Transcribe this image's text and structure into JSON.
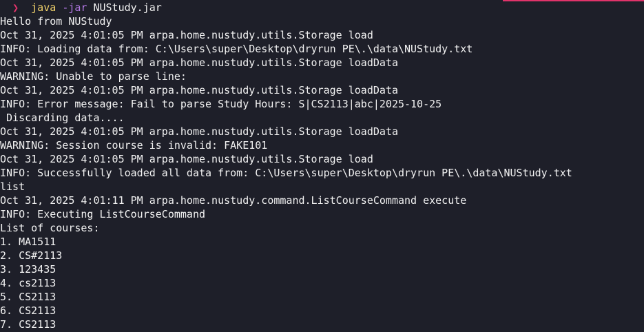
{
  "terminal": {
    "prompt": {
      "caret": "❯",
      "command": "java",
      "flag": "-jar",
      "argument": "NUStudy.jar"
    },
    "output": [
      "Hello from NUStudy",
      "Oct 31, 2025 4:01:05 PM arpa.home.nustudy.utils.Storage load",
      "INFO: Loading data from: C:\\Users\\super\\Desktop\\dryrun PE\\.\\data\\NUStudy.txt",
      "Oct 31, 2025 4:01:05 PM arpa.home.nustudy.utils.Storage loadData",
      "WARNING: Unable to parse line:",
      "Oct 31, 2025 4:01:05 PM arpa.home.nustudy.utils.Storage loadData",
      "INFO: Error message: Fail to parse Study Hours: S|CS2113|abc|2025-10-25",
      " Discarding data....",
      "Oct 31, 2025 4:01:05 PM arpa.home.nustudy.utils.Storage loadData",
      "WARNING: Session course is invalid: FAKE101",
      "Oct 31, 2025 4:01:05 PM arpa.home.nustudy.utils.Storage load",
      "INFO: Successfully loaded all data from: C:\\Users\\super\\Desktop\\dryrun PE\\.\\data\\NUStudy.txt",
      "list",
      "Oct 31, 2025 4:01:11 PM arpa.home.nustudy.command.ListCourseCommand execute",
      "INFO: Executing ListCourseCommand",
      "List of courses:",
      "1. MA1511",
      "2. CS#2113",
      "3. 123435",
      "4. cs2113",
      "5. CS2113",
      "6. CS2113",
      "7. CS2113"
    ]
  }
}
